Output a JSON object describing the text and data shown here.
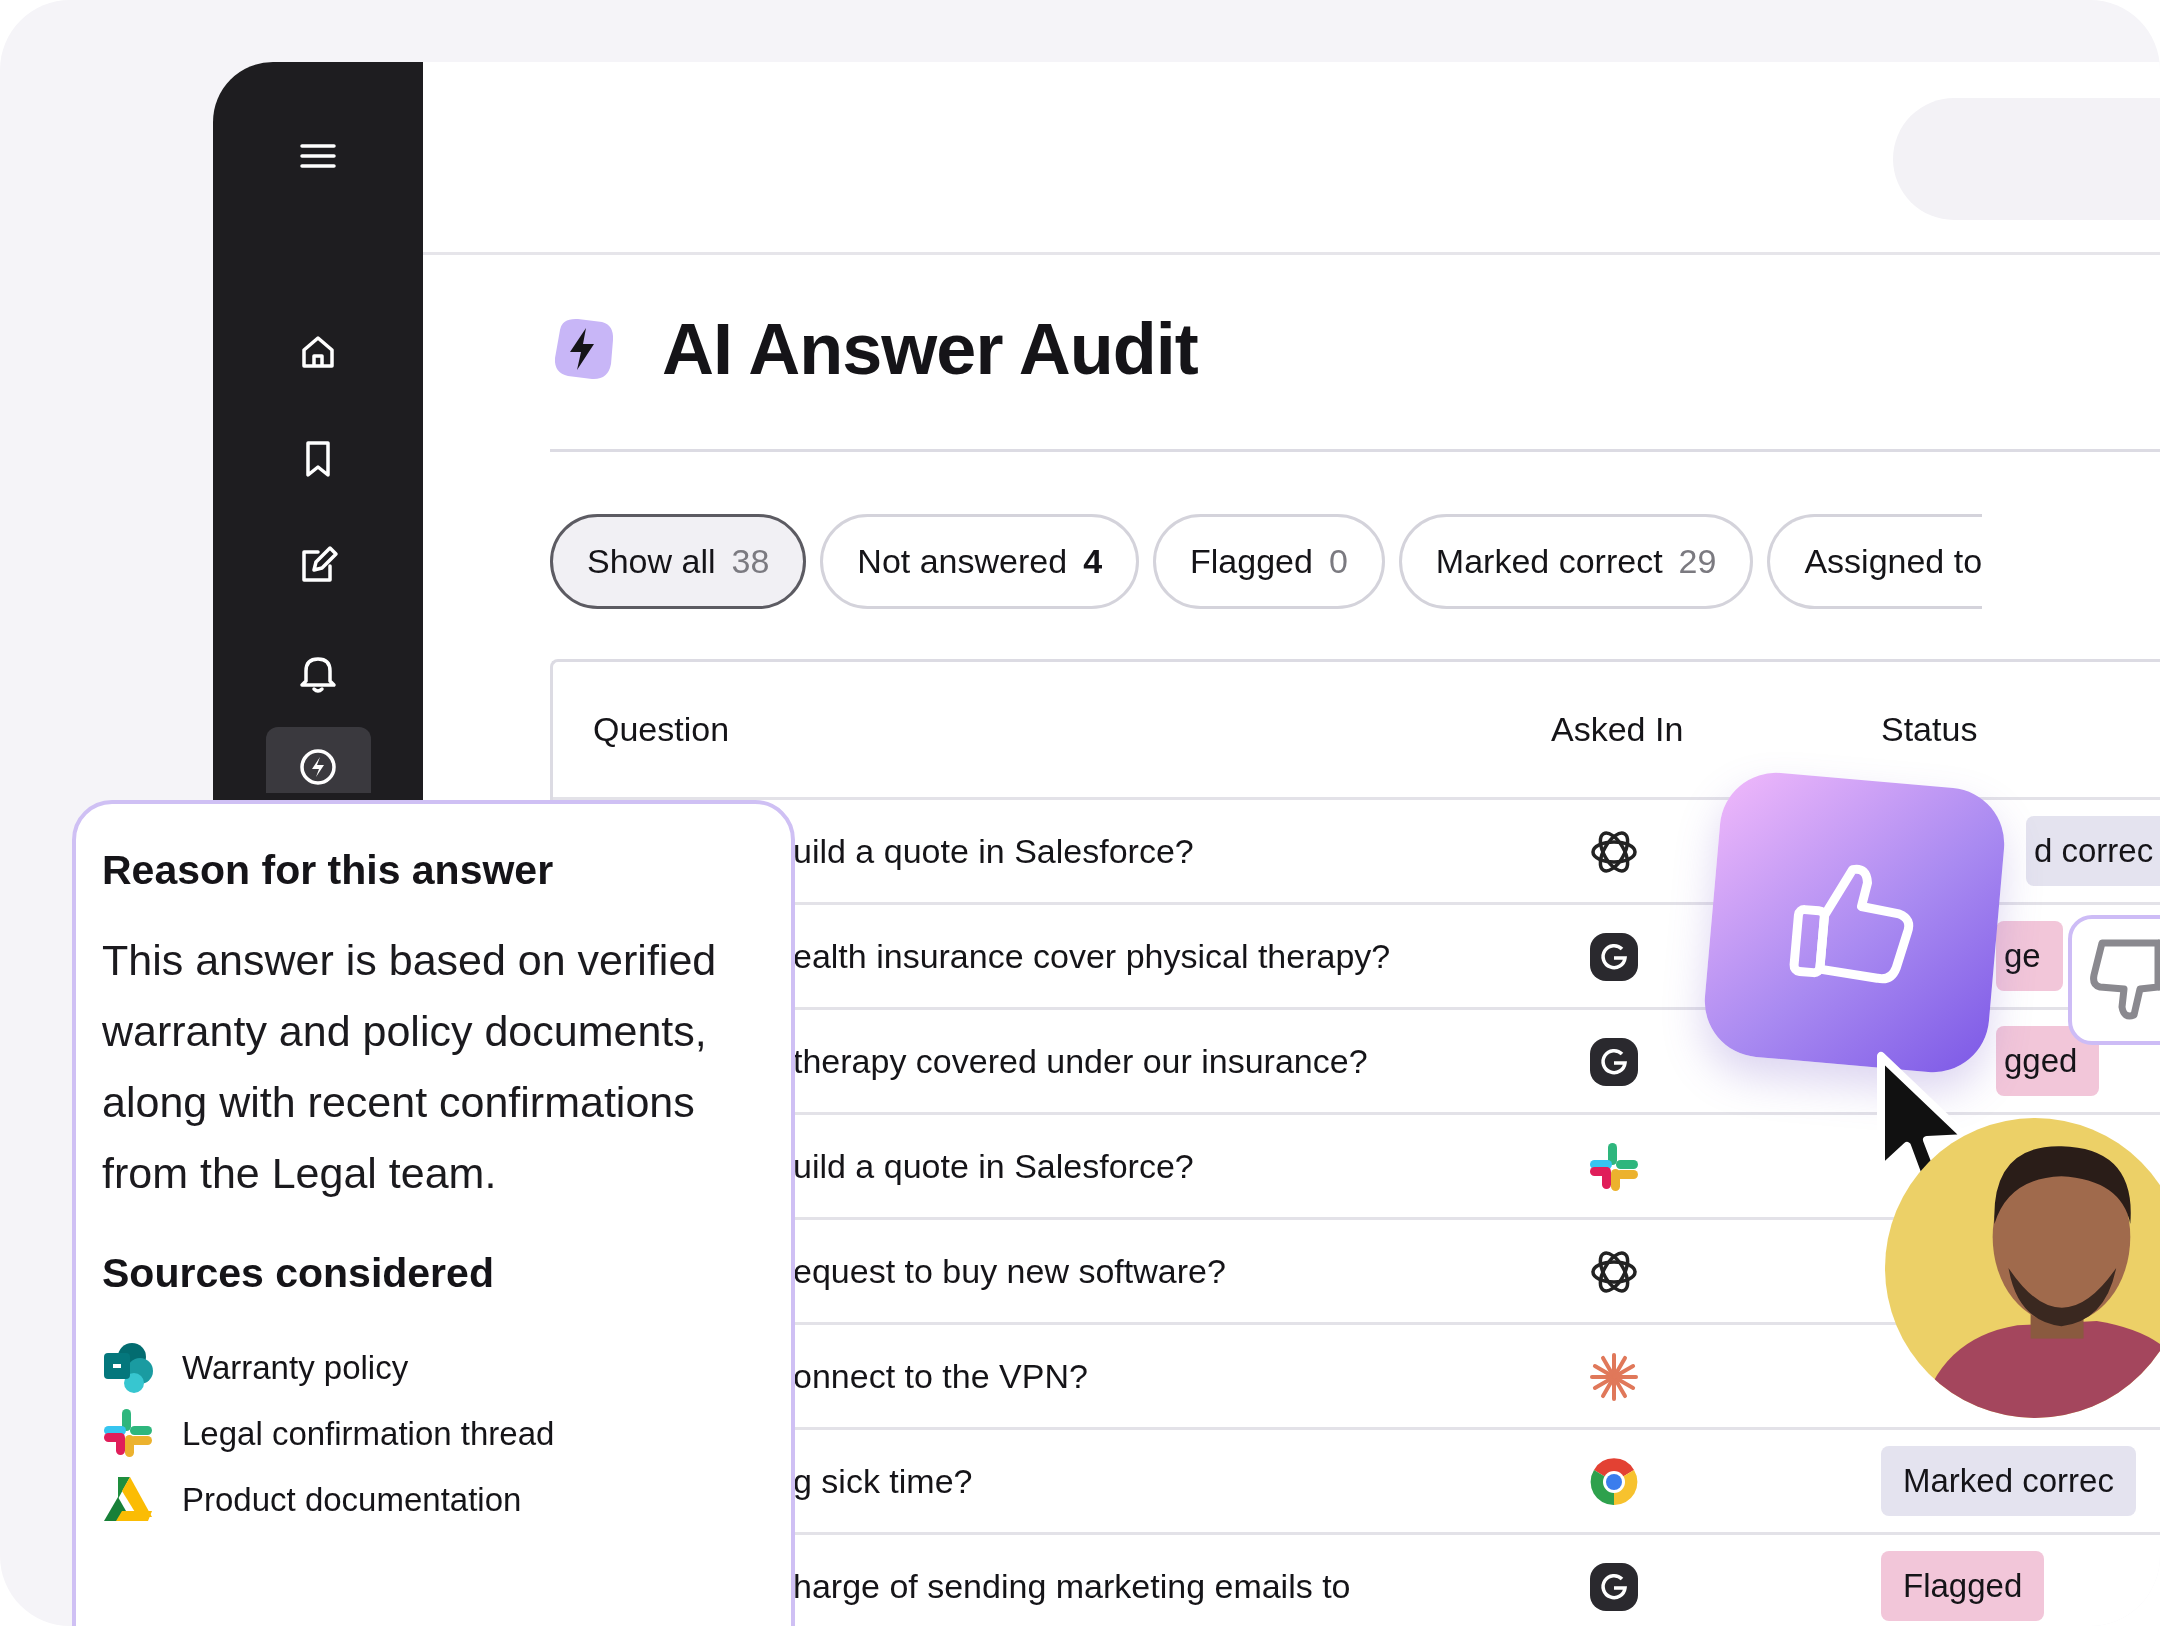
{
  "sidebar": {
    "items": [
      {
        "selected": false
      },
      {
        "selected": false
      },
      {
        "selected": false
      },
      {
        "selected": false
      },
      {
        "selected": false
      },
      {
        "selected": true
      }
    ]
  },
  "page": {
    "title": "AI Answer Audit"
  },
  "filters": [
    {
      "label": "Show all",
      "count": "38",
      "count_highlighted": false,
      "selected": true
    },
    {
      "label": "Not answered",
      "count": "4",
      "count_highlighted": true,
      "selected": false
    },
    {
      "label": "Flagged",
      "count": "0",
      "count_highlighted": false,
      "selected": false
    },
    {
      "label": "Marked correct",
      "count": "29",
      "count_highlighted": false,
      "selected": false
    },
    {
      "label": "Assigned to",
      "selected": false
    }
  ],
  "table": {
    "columns": [
      "Question",
      "Asked In",
      "Status"
    ],
    "rows": [
      {
        "question": "uild a quote in Salesforce?",
        "status": "d correc",
        "flagged": false
      },
      {
        "question": "ealth insurance cover physical therapy?",
        "status": "ge",
        "flagged": true
      },
      {
        "question": "therapy covered under our insurance?",
        "status": "gged",
        "flagged": true
      },
      {
        "question": "uild a quote in Salesforce?"
      },
      {
        "question": "equest to buy new software?"
      },
      {
        "question": "onnect to the VPN?"
      },
      {
        "question": "g sick time?",
        "status": "Marked correc",
        "flagged": false
      },
      {
        "question": "harge of sending marketing emails to",
        "status": "Flagged",
        "flagged": true
      }
    ]
  },
  "reason_panel": {
    "title": "Reason for this answer",
    "text": "This answer is based on verified warranty and policy documents, along with recent confirmations from the Legal team.",
    "sources_title": "Sources considered",
    "sources": [
      {
        "label": "Warranty policy"
      },
      {
        "label": "Legal confirmation thread"
      },
      {
        "label": "Product documentation"
      }
    ]
  }
}
